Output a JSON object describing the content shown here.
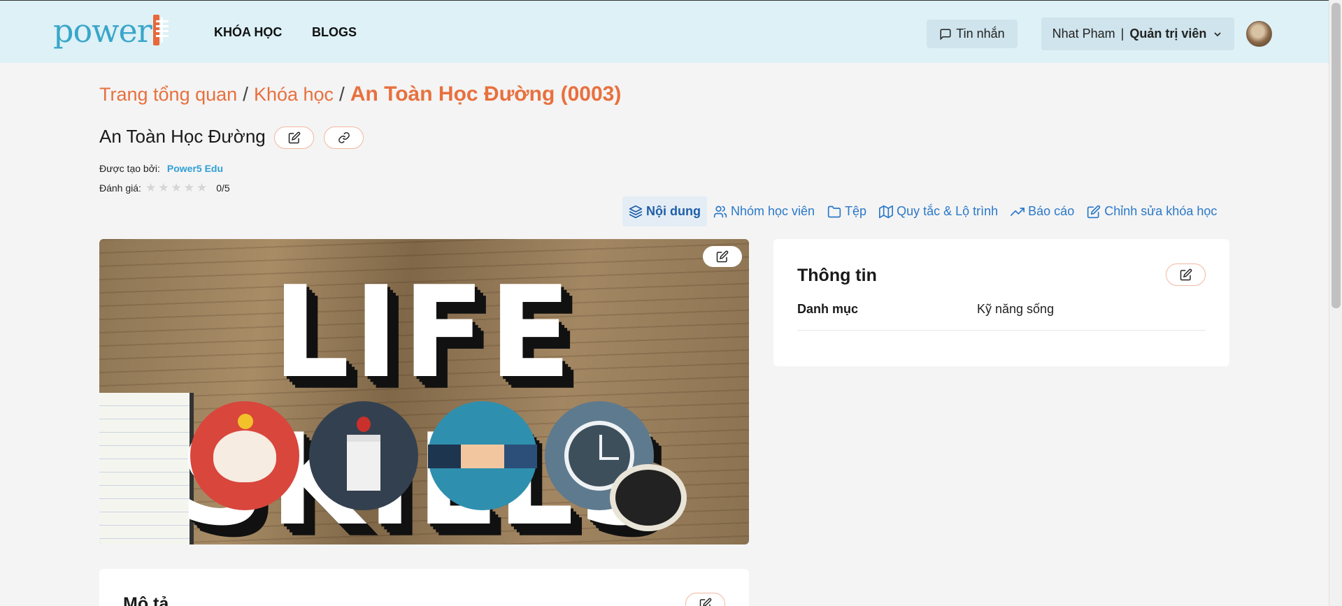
{
  "header": {
    "logo_text": "power",
    "nav": [
      "KHÓA HỌC",
      "BLOGS"
    ],
    "messages_label": "Tin nhắn",
    "user_name": "Nhat Pham",
    "user_sep": "|",
    "user_role": "Quản trị viên"
  },
  "breadcrumb": {
    "items": [
      "Trang tổng quan",
      "Khóa học"
    ],
    "separator": "/",
    "current": "An Toàn Học Đường (0003)"
  },
  "course": {
    "title": "An Toàn Học Đường",
    "created_by_label": "Được tạo bởi:",
    "created_by": "Power5 Edu",
    "rating_label": "Đánh giá:",
    "rating_text": "0/5",
    "rating_value": 0,
    "rating_max": 5,
    "image_text": "LIFE SKILLS"
  },
  "tabs": [
    {
      "label": "Nội dung",
      "icon": "layers-icon",
      "active": true
    },
    {
      "label": "Nhóm học viên",
      "icon": "users-icon",
      "active": false
    },
    {
      "label": "Tệp",
      "icon": "folder-icon",
      "active": false
    },
    {
      "label": "Quy tắc & Lộ trình",
      "icon": "map-icon",
      "active": false
    },
    {
      "label": "Báo cáo",
      "icon": "trending-up-icon",
      "active": false
    },
    {
      "label": "Chỉnh sửa khóa học",
      "icon": "edit-icon",
      "active": false
    }
  ],
  "info": {
    "title": "Thông tin",
    "category_label": "Danh mục",
    "category_value": "Kỹ năng sống"
  },
  "description": {
    "title": "Mô tả"
  },
  "colors": {
    "accent": "#e8703e",
    "link": "#2a78c8",
    "header_bg": "#ddf1f7"
  }
}
